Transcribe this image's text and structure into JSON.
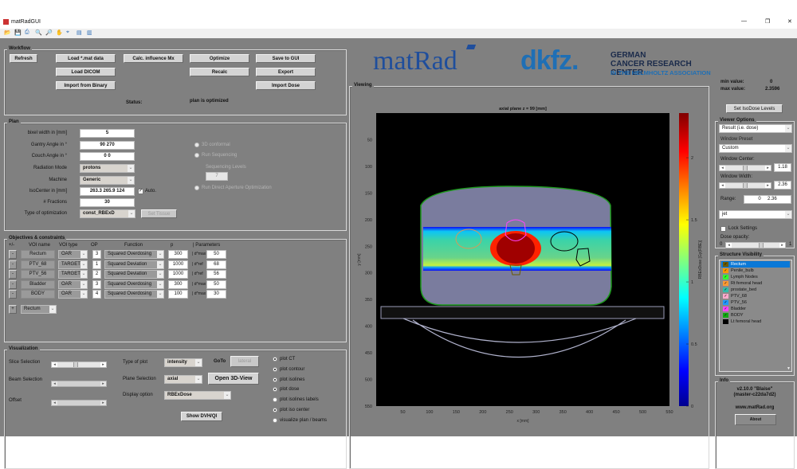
{
  "window": {
    "title": "matRadGUI",
    "min": "—",
    "max": "❐",
    "close": "✕"
  },
  "toolbar": {
    "icons": [
      "open-icon",
      "save-icon",
      "print-icon",
      "zoom-in-icon",
      "zoom-out-icon",
      "pan-icon",
      "datacursor-icon",
      "colorbar-icon",
      "legend-icon"
    ]
  },
  "workflow": {
    "title": "Workflow",
    "refresh": "Refresh",
    "load_mat": "Load *.mat data",
    "load_dicom": "Load DICOM",
    "import_binary": "Import from Binary",
    "calc_influence": "Calc. influence Mx",
    "optimize": "Optimize",
    "recalc": "Recalc",
    "save_gui": "Save to GUI",
    "export": "Export",
    "import_dose": "Import Dose",
    "status_label": "Status:",
    "status_value": "plan is optimized"
  },
  "plan": {
    "title": "Plan",
    "bixel_label": "bixel width in [mm]",
    "bixel": "5",
    "gantry_label": "Gantry Angle in °",
    "gantry": "90 270",
    "couch_label": "Couch Angle in °",
    "couch": "0 0",
    "radmode_label": "Radiation Mode",
    "radmode": "protons",
    "machine_label": "Machine",
    "machine": "Generic",
    "iso_label": "IsoCenter in [mm]",
    "iso": "263.3 265.9 124",
    "auto_label": "Auto.",
    "fractions_label": "# Fractions",
    "fractions": "30",
    "opt_label": "Type of optimization",
    "opt": "const_RBExD",
    "set_tissue": "Set Tissue",
    "r3d": "3D conformal",
    "seq": "Run Sequencing",
    "seq_levels_label": "Sequencing Levels",
    "seq_levels": "7",
    "dao": "Run Direct Aperture Optimization"
  },
  "objectives": {
    "title": "Objectives & constraints",
    "headers": [
      "+/-",
      "VOI name",
      "VOI type",
      "OP",
      "Function",
      "p",
      "| Parameters"
    ],
    "rows": [
      {
        "name": "Rectum",
        "type": "OAR",
        "op": "3",
        "fn": "Squared Overdosing",
        "p": "300",
        "plabel": "| d^max",
        "param": "50"
      },
      {
        "name": "PTV_68",
        "type": "TARGET",
        "op": "1",
        "fn": "Squared Deviation",
        "p": "1000",
        "plabel": "| d^ref",
        "param": "68"
      },
      {
        "name": "PTV_56",
        "type": "TARGET",
        "op": "2",
        "fn": "Squared Deviation",
        "p": "1000",
        "plabel": "| d^ref",
        "param": "56"
      },
      {
        "name": "Bladder",
        "type": "OAR",
        "op": "3",
        "fn": "Squared Overdosing",
        "p": "300",
        "plabel": "| d^max",
        "param": "50"
      },
      {
        "name": "BODY",
        "type": "OAR",
        "op": "4",
        "fn": "Squared Overdosing",
        "p": "100",
        "plabel": "| d^max",
        "param": "30"
      }
    ],
    "remove": "-",
    "add": "+",
    "add_voi": "Rectum"
  },
  "viz": {
    "title": "Visualization",
    "slice": "Slice Selection",
    "slice_value": 0.4,
    "beam": "Beam Selection",
    "offset": "Offset",
    "type_label": "Type of plot",
    "type": "intensity",
    "goto": "GoTo",
    "lateral": "lateral",
    "plane_label": "Plane Selection",
    "plane": "axial",
    "open3d": "Open 3D-View",
    "display_label": "Display option",
    "display": "RBExDose",
    "dvh": "Show DVH/QI",
    "radios": [
      {
        "label": "plot CT",
        "on": true
      },
      {
        "label": "plot contour",
        "on": true
      },
      {
        "label": "plot isolines",
        "on": true
      },
      {
        "label": "plot dose",
        "on": true
      },
      {
        "label": "plot isolines labels",
        "on": false
      },
      {
        "label": "plot iso center",
        "on": true
      },
      {
        "label": "visualize plan / beams",
        "on": false
      }
    ]
  },
  "logo": {
    "matrad": "matRad",
    "dkfz": "dkfz.",
    "line1": "GERMAN",
    "line2": "CANCER RESEARCH CENTER",
    "line3": "IN THE HELMHOLTZ ASSOCIATION",
    "colors": {
      "matrad": "#1f4e9c",
      "accent": "#f2a900",
      "dkfz": "#1f6fb5"
    }
  },
  "values": {
    "min_label": "min value:",
    "min": "0",
    "max_label": "max  value:",
    "max": "2.3596",
    "iso_btn": "Set IsoDose Levels"
  },
  "viewer": {
    "title": "Viewer Options",
    "result": "Result (i.e. dose)",
    "preset_label": "Window Preset",
    "preset": "Custom",
    "center_label": "Window Center:",
    "center": "1.18",
    "center_frac": 0.5,
    "width_label": "Window Width:",
    "width": "2.36",
    "width_frac": 0.5,
    "range_label": "Range:",
    "range": "0     2.36",
    "colormap": "jet",
    "lock": "Lock Settings",
    "opacity_label": "Dose opacity:",
    "opacity_min": "0",
    "opacity_max": "1",
    "opacity": 0.6
  },
  "structures": {
    "title": "Structure Visibility",
    "items": [
      {
        "name": "Rectum",
        "color": "#6b5a00"
      },
      {
        "name": "Penile_bulb",
        "color": "#ff9900"
      },
      {
        "name": "Lymph Nodes",
        "color": "#33ff33"
      },
      {
        "name": "Rt femoral head",
        "color": "#ff9933"
      },
      {
        "name": "prostate_bed",
        "color": "#33bbaa"
      },
      {
        "name": "PTV_68",
        "color": "#ffaacc"
      },
      {
        "name": "PTV_56",
        "color": "#2299ff"
      },
      {
        "name": "Bladder",
        "color": "#ff44ff"
      },
      {
        "name": "BODY",
        "color": "#11aa11"
      },
      {
        "name": "Lt femoral head",
        "color": "#000000"
      }
    ]
  },
  "info": {
    "title": "Info",
    "version": "v2.10.0 \"Blaise\"",
    "branch": "(master-c22da7d2)",
    "url": "www.matRad.org",
    "about": "About"
  },
  "viewing": {
    "title": "Viewing"
  },
  "chart_data": {
    "type": "heatmap",
    "title": "axial plane z = 99 [mm]",
    "xlabel": "x [mm]",
    "ylabel": "y [mm]",
    "xticks": [
      50,
      100,
      150,
      200,
      250,
      300,
      350,
      400,
      450,
      500,
      550
    ],
    "yticks": [
      50,
      100,
      150,
      200,
      250,
      300,
      350,
      400,
      450,
      500,
      550
    ],
    "xlim": [
      0,
      550
    ],
    "ylim": [
      0,
      550
    ],
    "colorbar": {
      "label": "RBExDose [Gy(RBE)]",
      "ticks": [
        0,
        0.5,
        1,
        1.5,
        2
      ],
      "tick_labels": [
        "0",
        "0.5",
        "1",
        "1.5",
        "2"
      ],
      "range": [
        0,
        2.3596
      ],
      "colormap": "jet"
    }
  }
}
